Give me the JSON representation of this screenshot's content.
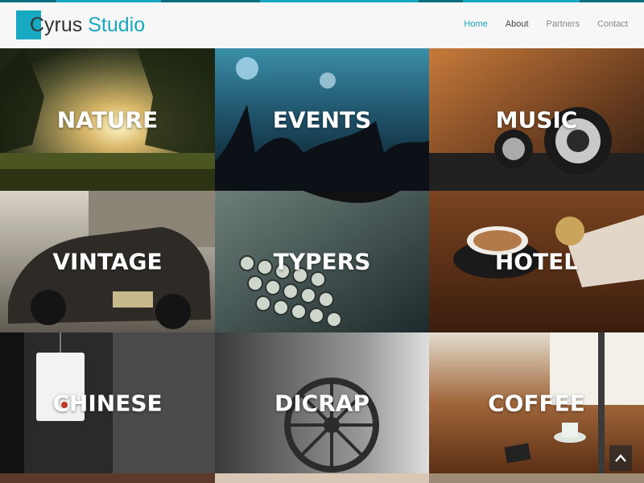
{
  "brand": {
    "part1": "Cyrus",
    "part2": "Studio",
    "accent_color": "#17a8c2"
  },
  "nav": {
    "items": [
      {
        "label": "Home",
        "active": true
      },
      {
        "label": "About",
        "active": false
      },
      {
        "label": "Partners",
        "active": false
      },
      {
        "label": "Contact",
        "active": false
      }
    ]
  },
  "gallery": {
    "tiles": [
      {
        "label": "NATURE"
      },
      {
        "label": "EVENTS"
      },
      {
        "label": "MUSIC"
      },
      {
        "label": "VINTAGE"
      },
      {
        "label": "TYPERS"
      },
      {
        "label": "HOTEL"
      },
      {
        "label": "CHINESE"
      },
      {
        "label": "DICRAP"
      },
      {
        "label": "COFFEE"
      }
    ]
  },
  "scroll_top": {
    "icon": "chevron-up-icon"
  }
}
